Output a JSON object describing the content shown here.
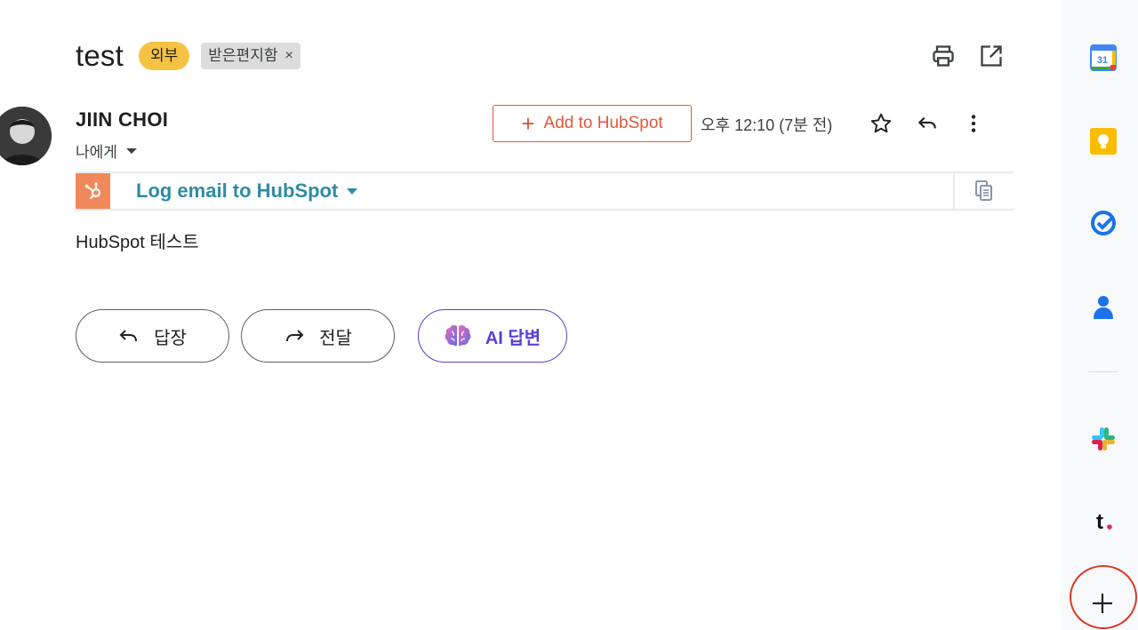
{
  "email": {
    "subject": "test",
    "external_chip": "외부",
    "label_chip": "받은편지함",
    "label_chip_close": "×",
    "sender_name": "JIIN CHOI",
    "recipient": "나에게",
    "time": "오후 12:10 (7분 전)",
    "body": "HubSpot 테스트"
  },
  "hubspot": {
    "add_button": "Add to HubSpot",
    "add_plus": "+",
    "log_email": "Log email to HubSpot",
    "brand_color": "#f0885a",
    "link_color": "#2e8ca5"
  },
  "actions": {
    "reply": "답장",
    "forward": "전달",
    "ai_reply": "AI 답변"
  },
  "side_panel": {
    "calendar_day": "31",
    "tl_letter": "t"
  },
  "colors": {
    "external_chip": "#f6c242",
    "hubspot_button": "#e4573d",
    "ai_accent": "#5b3fd6",
    "highlight_circle": "#d93a27"
  }
}
